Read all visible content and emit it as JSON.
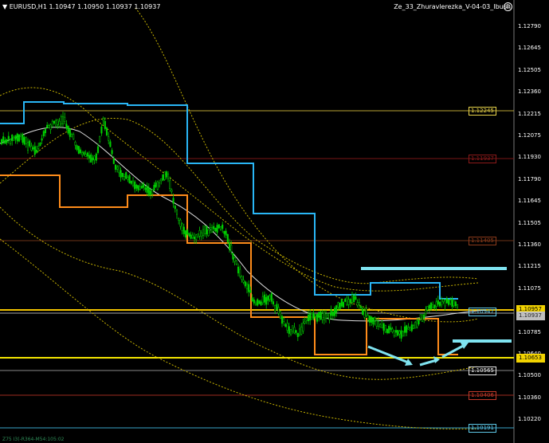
{
  "window": {
    "symbol_info": "EURUSD,H1  1.10947 1.10950 1.10937 1.10937",
    "expert_name": "Ze_33_Zhuravlerezka_V-04-03_Ibush",
    "footer_text": "Z75 I3(-R364-M54:105:02"
  },
  "axis": {
    "ticks": [
      "1.12790",
      "1.12645",
      "1.12505",
      "1.12360",
      "1.12215",
      "1.12075",
      "1.11930",
      "1.11790",
      "1.11645",
      "1.11505",
      "1.11360",
      "1.11215",
      "1.11075",
      "1.10935",
      "1.10785",
      "1.10640",
      "1.10500",
      "1.10360",
      "1.10220"
    ]
  },
  "levels": [
    {
      "label": "1.12245",
      "color": "#e8d34a"
    },
    {
      "label": "1.11937",
      "color": "#8b1a1a"
    },
    {
      "label": "1.11405",
      "color": "#8b3a1a"
    },
    {
      "label": "1.10947",
      "color": "#5fc9e8"
    },
    {
      "label": "1.10565",
      "color": "#e8e8e8"
    },
    {
      "label": "1.10406",
      "color": "#c23a2a"
    },
    {
      "label": "1.10191",
      "color": "#5fc9e8"
    }
  ],
  "price_boxes": [
    {
      "label": "1.10957",
      "color": "#f2d300"
    },
    {
      "label": "1.10937",
      "color": "#bfbfbf"
    },
    {
      "label": "1.10653",
      "color": "#f2d300"
    }
  ],
  "colors": {
    "candle": "#00d000",
    "blue_channel": "#29b6f6",
    "orange_channel": "#ff8c1a",
    "arrow": "#7fe3f0"
  }
}
